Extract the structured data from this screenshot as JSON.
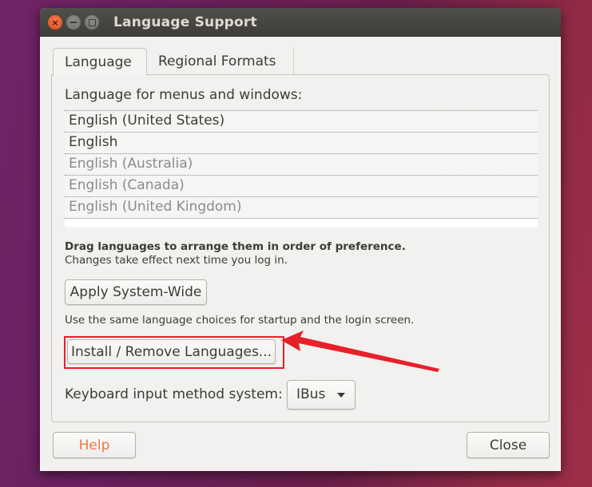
{
  "window": {
    "title": "Language Support",
    "controls": {
      "close": "×",
      "minimize": "minimize",
      "maximize": "maximize"
    }
  },
  "tabs": [
    {
      "label": "Language",
      "active": true
    },
    {
      "label": "Regional Formats",
      "active": false
    }
  ],
  "language_tab": {
    "section_label": "Language for menus and windows:",
    "languages": [
      {
        "label": "English (United States)",
        "enabled": true
      },
      {
        "label": "English",
        "enabled": true
      },
      {
        "label": "English (Australia)",
        "enabled": false
      },
      {
        "label": "English (Canada)",
        "enabled": false
      },
      {
        "label": "English (United Kingdom)",
        "enabled": false
      }
    ],
    "drag_hint": "Drag languages to arrange them in order of preference.",
    "effect_hint": "Changes take effect next time you log in.",
    "apply_button": "Apply System-Wide",
    "apply_hint": "Use the same language choices for startup and the login screen.",
    "install_button": "Install / Remove Languages...",
    "keyboard_label": "Keyboard input method system:",
    "keyboard_value": "IBus"
  },
  "footer": {
    "help_button": "Help",
    "close_button": "Close"
  },
  "annotation": {
    "highlight_color": "#e8202a",
    "target": "Install / Remove Languages..."
  }
}
